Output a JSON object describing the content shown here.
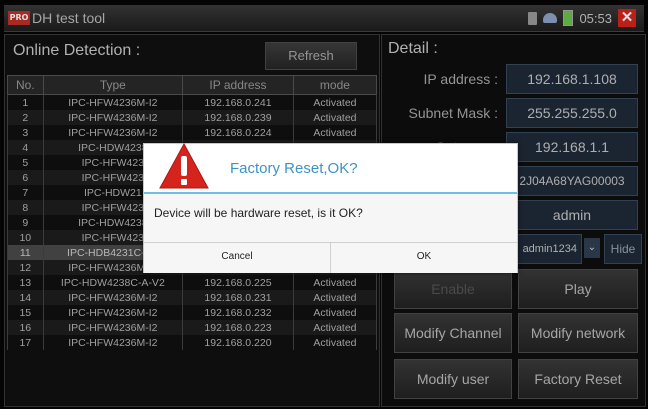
{
  "app": {
    "logo": "PRO",
    "title": "DH test tool",
    "time": "05:53"
  },
  "left_panel": {
    "title": "Online Detection :",
    "refresh_label": "Refresh",
    "columns": [
      "No.",
      "Type",
      "IP address",
      "mode"
    ],
    "rows": [
      {
        "no": "1",
        "type": "IPC-HFW4236M-I2",
        "ip": "192.168.0.241",
        "mode": "Activated"
      },
      {
        "no": "2",
        "type": "IPC-HFW4236M-I2",
        "ip": "192.168.0.239",
        "mode": "Activated"
      },
      {
        "no": "3",
        "type": "IPC-HFW4236M-I2",
        "ip": "192.168.0.224",
        "mode": "Activated"
      },
      {
        "no": "4",
        "type": "IPC-HDW4238",
        "ip": "",
        "mode": ""
      },
      {
        "no": "5",
        "type": "IPC-HFW423",
        "ip": "",
        "mode": ""
      },
      {
        "no": "6",
        "type": "IPC-HFW423",
        "ip": "",
        "mode": ""
      },
      {
        "no": "7",
        "type": "IPC-HDW21",
        "ip": "",
        "mode": ""
      },
      {
        "no": "8",
        "type": "IPC-HFW423",
        "ip": "",
        "mode": ""
      },
      {
        "no": "9",
        "type": "IPC-HDW4238",
        "ip": "",
        "mode": ""
      },
      {
        "no": "10",
        "type": "IPC-HFW423",
        "ip": "",
        "mode": ""
      },
      {
        "no": "11",
        "type": "IPC-HDB4231C-AS",
        "ip": "192.168.1.108",
        "mode": "Activated"
      },
      {
        "no": "12",
        "type": "IPC-HFW4236M-I2",
        "ip": "192.168.0.234",
        "mode": "Activated"
      },
      {
        "no": "13",
        "type": "IPC-HDW4238C-A-V2",
        "ip": "192.168.0.225",
        "mode": "Activated"
      },
      {
        "no": "14",
        "type": "IPC-HFW4236M-I2",
        "ip": "192.168.0.231",
        "mode": "Activated"
      },
      {
        "no": "15",
        "type": "IPC-HFW4236M-I2",
        "ip": "192.168.0.232",
        "mode": "Activated"
      },
      {
        "no": "16",
        "type": "IPC-HFW4236M-I2",
        "ip": "192.168.0.223",
        "mode": "Activated"
      },
      {
        "no": "17",
        "type": "IPC-HFW4236M-I2",
        "ip": "192.168.0.220",
        "mode": "Activated"
      }
    ],
    "selected_row": 10
  },
  "detail": {
    "title": "Detail :",
    "ip_label": "IP address :",
    "ip_value": "192.168.1.108",
    "mask_label": "Subnet Mask :",
    "mask_value": "255.255.255.0",
    "gateway_label": "Gateway :",
    "gateway_value": "192.168.1.1",
    "serial_value": "2J04A68YAG00003",
    "user_value": "admin",
    "password_value": "admin1234",
    "hide_label": "Hide",
    "enable_label": "Enable",
    "play_label": "Play",
    "modify_channel_label": "Modify Channel",
    "modify_network_label": "Modify network",
    "modify_user_label": "Modify user",
    "factory_reset_label": "Factory Reset"
  },
  "dialog": {
    "title": "Factory Reset,OK?",
    "message": "Device will be hardware reset, is it OK?",
    "cancel_label": "Cancel",
    "ok_label": "OK"
  },
  "colors": {
    "accent": "#3d93c4",
    "warning": "#d5241c",
    "dialog_rule": "#6dc0e4"
  }
}
